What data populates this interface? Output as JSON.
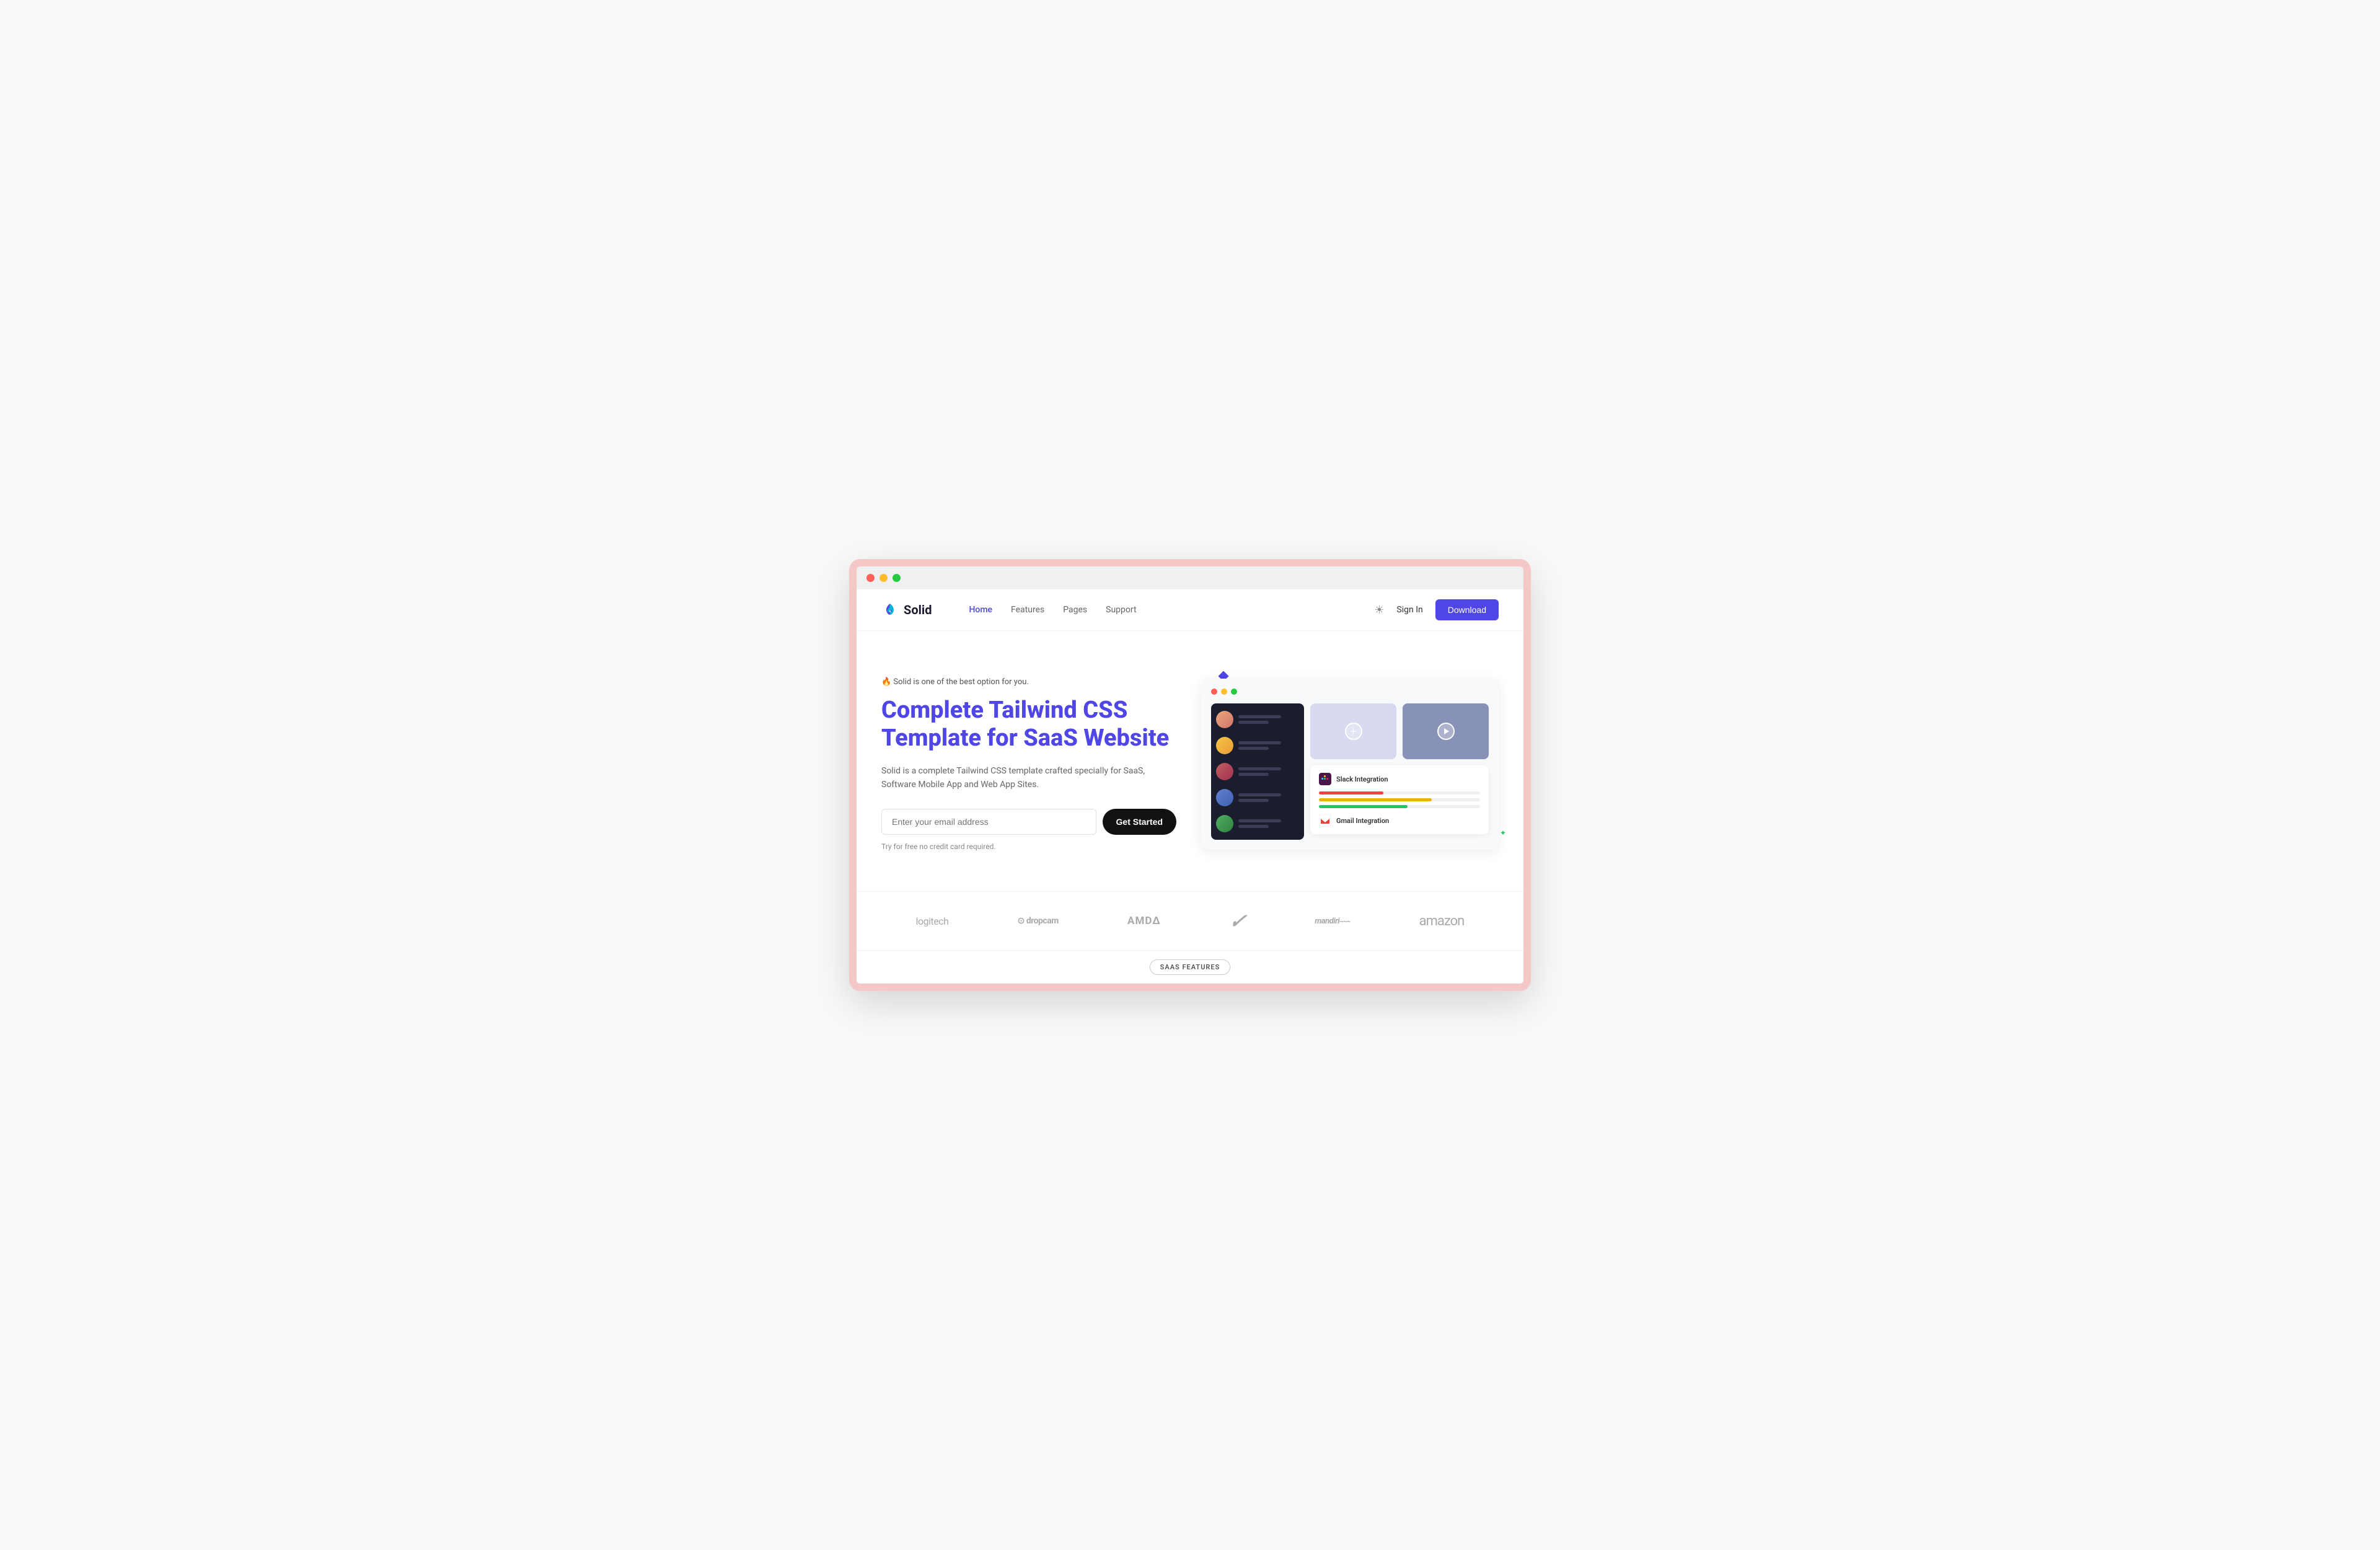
{
  "browser": {
    "traffic_lights": [
      "red",
      "yellow",
      "green"
    ]
  },
  "nav": {
    "logo_text": "Solid",
    "links": [
      {
        "label": "Home",
        "active": true
      },
      {
        "label": "Features",
        "active": false
      },
      {
        "label": "Pages",
        "active": false
      },
      {
        "label": "Support",
        "active": false
      }
    ],
    "sign_in": "Sign In",
    "download": "Download"
  },
  "hero": {
    "badge": "🔥 Solid is one of the best option for you.",
    "title_line1": "Complete Tailwind CSS",
    "title_line2": "Template for SaaS Website",
    "description": "Solid is a complete Tailwind CSS template crafted specially for SaaS, Software Mobile App and Web App Sites.",
    "input_placeholder": "Enter your email address",
    "cta_button": "Get Started",
    "note": "Try for free no credit card required."
  },
  "integrations": [
    {
      "name": "Slack Integration",
      "color": "#4a154b"
    },
    {
      "name": "Gmail Integration",
      "color": "#ea4335"
    }
  ],
  "progress_bars": [
    {
      "color": "#ef4444",
      "width": "40%"
    },
    {
      "color": "#eab308",
      "width": "70%"
    },
    {
      "color": "#22c55e",
      "width": "55%"
    }
  ],
  "brands": [
    {
      "name": "logitech",
      "label": "logitech"
    },
    {
      "name": "dropcam",
      "label": "⊙ dropcam"
    },
    {
      "name": "amd",
      "label": "AMD∆"
    },
    {
      "name": "nike",
      "label": "✓"
    },
    {
      "name": "mandiri",
      "label": "mandiri~~~"
    },
    {
      "name": "amazon",
      "label": "amazon"
    }
  ],
  "saas_section": {
    "badge": "SAAS FEATURES"
  }
}
